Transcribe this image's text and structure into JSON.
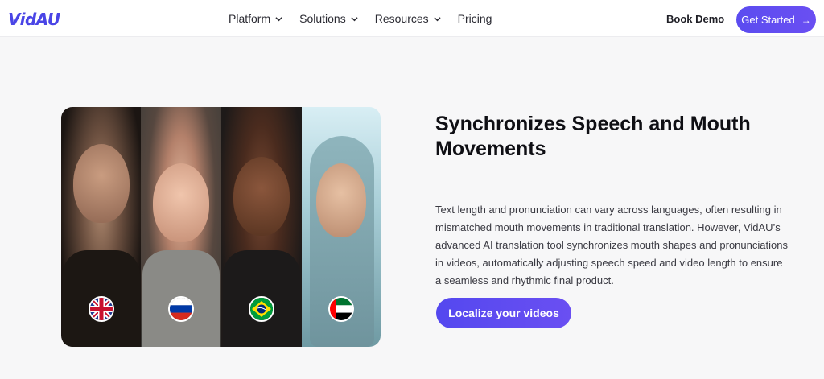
{
  "brand": {
    "logo_text": "VidAU",
    "accent": "#4a45e6"
  },
  "nav": {
    "items": [
      {
        "label": "Platform",
        "has_dropdown": true
      },
      {
        "label": "Solutions",
        "has_dropdown": true
      },
      {
        "label": "Resources",
        "has_dropdown": true
      },
      {
        "label": "Pricing",
        "has_dropdown": false
      }
    ],
    "book_demo": "Book Demo",
    "get_started": "Get Started",
    "get_started_icon": "arrow-right-icon"
  },
  "hero": {
    "flags": [
      {
        "name": "uk-flag-icon"
      },
      {
        "name": "russia-flag-icon"
      },
      {
        "name": "brazil-flag-icon"
      },
      {
        "name": "uae-flag-icon"
      }
    ]
  },
  "feature": {
    "title": "Synchronizes Speech and Mouth Movements",
    "description": "Text length and pronunciation can vary across languages, often resulting in mismatched mouth movements in traditional translation. However, VidAU’s advanced AI translation tool synchronizes mouth shapes and pronunciations in videos, automatically adjusting speech speed and video length to ensure a seamless and rhythmic final product.",
    "cta": "Localize your videos",
    "cta_color": "#5a4bf0"
  }
}
